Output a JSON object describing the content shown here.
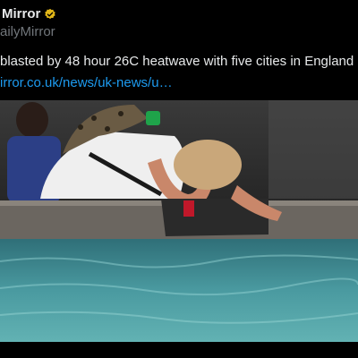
{
  "account": {
    "display_name": "Mirror",
    "handle": "ailyMirror",
    "badge_icon": "verified-gold-badge-icon",
    "badge_color": "#e2b719"
  },
  "tweet": {
    "text": "blasted by 48 hour 26C heatwave with five cities in England",
    "link_text": "irror.co.uk/news/uk-news/u…",
    "link_color": "#1d9bf0"
  },
  "media": {
    "type": "photo"
  }
}
